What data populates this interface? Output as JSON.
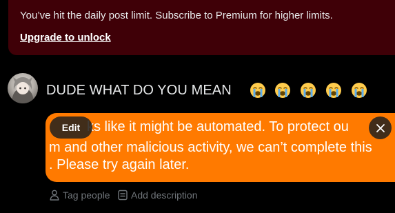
{
  "limit_banner": {
    "message": "You’ve hit the daily post limit. Subscribe to Premium for higher limits.",
    "link_label": "Upgrade to unlock",
    "background_color": "#3f0007"
  },
  "composer": {
    "post_text": "DUDE WHAT DO YOU MEAN",
    "emoji_icon": "loudly-crying-face-icon",
    "emoji_count": 5
  },
  "media": {
    "background_color": "#ff7a00",
    "error_lines": [
      "ks like it might be automated. To protect ou",
      "m and other malicious activity, we can’t complete this",
      ". Please try again later."
    ],
    "edit_label": "Edit",
    "close_icon": "close-icon"
  },
  "media_actions": {
    "tag_people_label": "Tag people",
    "add_description_label": "Add description"
  }
}
